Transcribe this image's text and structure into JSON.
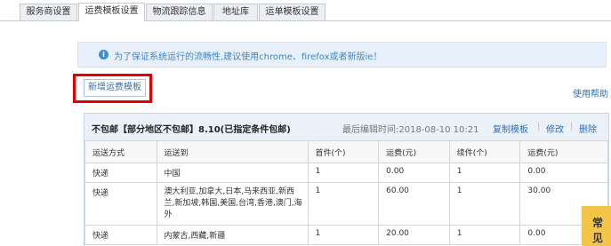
{
  "tabs": [
    {
      "label": "服务商设置",
      "active": false
    },
    {
      "label": "运费模板设置",
      "active": true
    },
    {
      "label": "物流跟踪信息",
      "active": false
    },
    {
      "label": "地址库",
      "active": false
    },
    {
      "label": "运单模板设置",
      "active": false
    }
  ],
  "notice": {
    "icon": "info-icon",
    "text": "为了保证系统运行的流畅性,建议使用chrome、firefox或者新版ie！"
  },
  "toolbar": {
    "add_label": "新增运费模板",
    "help_label": "使用帮助"
  },
  "template": {
    "title": "不包邮【部分地区不包邮】8.10(已指定条件包邮)",
    "last_edit": "最后编辑时间:2018-08-10 10:21",
    "actions": {
      "copy": "复制模板",
      "edit": "修改",
      "delete": "删除"
    },
    "columns": [
      "运送方式",
      "运送到",
      "首件(个)",
      "运费(元)",
      "续件(个)",
      "运费(元)"
    ],
    "rows": [
      [
        "快递",
        "中国",
        "1",
        "0.00",
        "1",
        "0.00"
      ],
      [
        "快递",
        "澳大利亚,加拿大,日本,马来西亚,新西兰,新加坡,韩国,美国,台湾,香港,澳门,海外",
        "1",
        "60.00",
        "1",
        "30.00"
      ],
      [
        "快递",
        "内蒙古,西藏,新疆",
        "1",
        "20.00",
        "1",
        "0.00"
      ]
    ]
  },
  "float_tab": {
    "label": "常见"
  }
}
